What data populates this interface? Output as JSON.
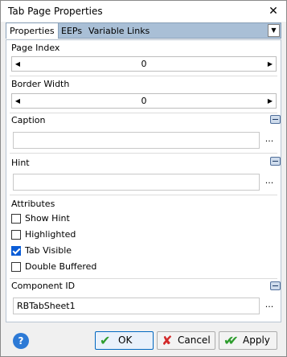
{
  "dialog": {
    "title": "Tab Page Properties",
    "close_glyph": "✕"
  },
  "tabs": [
    "Properties",
    "EEPs",
    "Variable Links"
  ],
  "page_index": {
    "label": "Page Index",
    "value": "0"
  },
  "border_width": {
    "label": "Border Width",
    "value": "0"
  },
  "caption": {
    "label": "Caption",
    "value": ""
  },
  "hint": {
    "label": "Hint",
    "value": ""
  },
  "attributes": {
    "label": "Attributes",
    "items": [
      {
        "label": "Show Hint",
        "checked": false
      },
      {
        "label": "Highlighted",
        "checked": false
      },
      {
        "label": "Tab Visible",
        "checked": true
      },
      {
        "label": "Double Buffered",
        "checked": false
      }
    ]
  },
  "component_id": {
    "label": "Component ID",
    "value": "RBTabSheet1"
  },
  "ellipsis": "...",
  "buttons": {
    "ok": "OK",
    "cancel": "Cancel",
    "apply": "Apply"
  },
  "colors": {
    "accent": "#0067c0",
    "tab_bar": "#a9bfd6",
    "ok_check": "#2e9d2e",
    "cancel_x": "#d22a2a"
  },
  "icons": {
    "help": "help-icon",
    "ok": "checkmark-icon",
    "cancel": "x-icon",
    "apply": "double-check-icon",
    "dropdown": "chevron-down-icon"
  }
}
